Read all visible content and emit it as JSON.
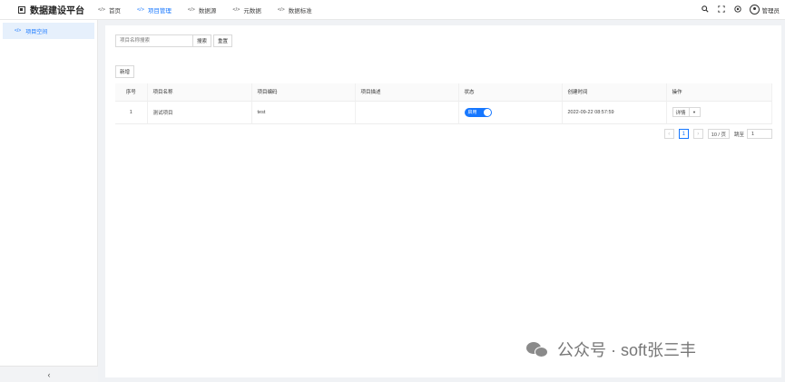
{
  "app": {
    "title": "数据建设平台",
    "logo_icon": "grid-logo-icon"
  },
  "nav": {
    "items": [
      {
        "label": "首页",
        "icon": "code-icon",
        "active": false
      },
      {
        "label": "项目管理",
        "icon": "code-icon",
        "active": true
      },
      {
        "label": "数据源",
        "icon": "code-icon",
        "active": false
      },
      {
        "label": "元数据",
        "icon": "code-icon",
        "active": false
      },
      {
        "label": "数据标准",
        "icon": "code-icon",
        "active": false
      }
    ],
    "code_glyph": "</>"
  },
  "header": {
    "icons": [
      "search-icon",
      "fullscreen-icon",
      "help-icon"
    ],
    "user": {
      "label": "管理员",
      "icon": "avatar-icon"
    }
  },
  "sidebar": {
    "items": [
      {
        "label": "项目空间",
        "active": true
      }
    ],
    "collapse_glyph": "‹"
  },
  "main": {
    "search": {
      "placeholder": "项目名称搜索",
      "search_label": "搜索",
      "reset_label": "重置"
    },
    "add_label": "新增",
    "table": {
      "headers": [
        "序号",
        "项目名称",
        "项目编码",
        "项目描述",
        "状态",
        "创建时间",
        "操作"
      ],
      "rows": [
        {
          "idx": "1",
          "name": "测试项目",
          "code": "test",
          "desc": "",
          "status": "启用",
          "created": "2022-09-22 08:57:59",
          "action": "详情"
        }
      ]
    },
    "pager": {
      "current": "1",
      "size_label": "10 / 页",
      "jump_label": "跳至",
      "jump_value": "1"
    }
  },
  "watermark": {
    "text": "公众号 · soft张三丰"
  },
  "colors": {
    "accent": "#1677ff"
  }
}
